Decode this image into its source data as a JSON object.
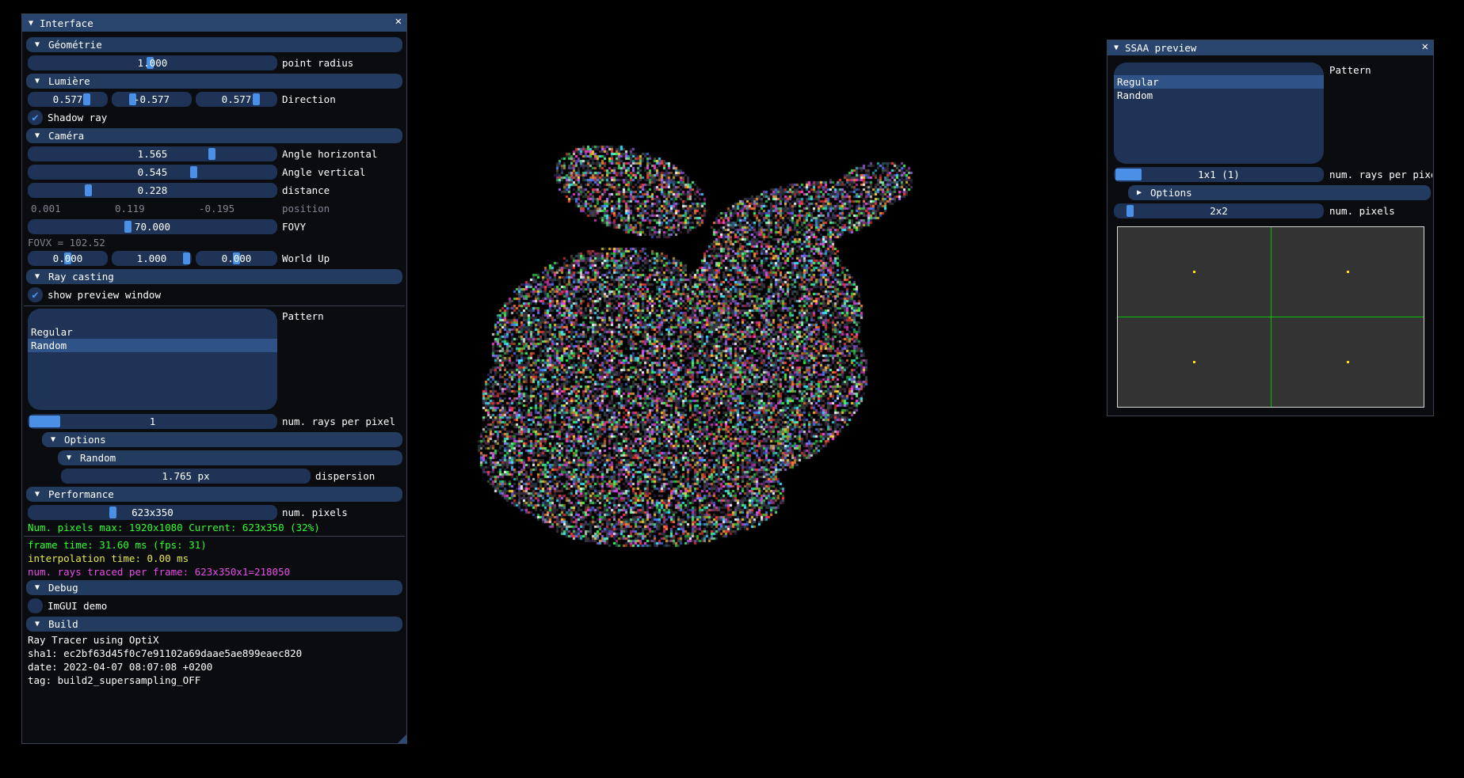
{
  "interface": {
    "title": "Interface",
    "geometry": {
      "header": "Géométrie",
      "point_radius": {
        "value": "1.000",
        "label": "point radius",
        "level": 0.48
      }
    },
    "light": {
      "header": "Lumière",
      "direction": {
        "x": "0.577",
        "y": "-0.577",
        "z": "0.577",
        "label": "Direction"
      },
      "shadow_ray": {
        "label": "Shadow ray",
        "checked": true
      }
    },
    "camera": {
      "header": "Caméra",
      "angle_h": {
        "value": "1.565",
        "label": "Angle horizontal",
        "level": 0.74
      },
      "angle_v": {
        "value": "0.545",
        "label": "Angle vertical",
        "level": 0.66
      },
      "distance": {
        "value": "0.228",
        "label": "distance",
        "level": 0.23
      },
      "position": {
        "x": "0.001",
        "y": "0.119",
        "z": "-0.195",
        "label": "position"
      },
      "fovy": {
        "value": "70.000",
        "label": "FOVY",
        "level": 0.39
      },
      "fovx": "FOVX = 102.52",
      "world_up": {
        "x": "0.000",
        "y": "1.000",
        "z": "0.000",
        "label": "World Up"
      }
    },
    "ray_casting": {
      "header": "Ray casting",
      "show_preview": {
        "label": "show preview window",
        "checked": true
      },
      "pattern_label": "Pattern",
      "patterns": [
        "Regular",
        "Random"
      ],
      "selected_pattern": "Random",
      "rays_per_pixel": {
        "value": "1",
        "label": "num. rays per pixel"
      },
      "options_header": "Options",
      "random_header": "Random",
      "dispersion": {
        "value": "1.765 px",
        "label": "dispersion"
      }
    },
    "performance": {
      "header": "Performance",
      "num_pixels": {
        "value": "623x350",
        "label": "num. pixels",
        "level": 0.33
      },
      "pixels_info": "Num. pixels max: 1920x1080 Current: 623x350 (32%)",
      "frame_time": "frame time: 31.60 ms (fps: 31)",
      "interp_time": "interpolation time: 0.00 ms",
      "rays_traced": "num. rays traced per frame: 623x350x1=218050"
    },
    "debug": {
      "header": "Debug",
      "imgui_demo": {
        "label": "ImGUI demo",
        "checked": false
      }
    },
    "build": {
      "header": "Build",
      "line1": "Ray Tracer using OptiX",
      "sha": "sha1: ec2bf63d45f0c7e91102a69daae5ae899eaec820",
      "date": "date: 2022-04-07 08:07:08 +0200",
      "tag": "tag: build2_supersampling_OFF"
    }
  },
  "ssaa": {
    "title": "SSAA preview",
    "pattern_label": "Pattern",
    "patterns": [
      "Regular",
      "Random"
    ],
    "selected_pattern": "Regular",
    "rays_per_pixel": {
      "value": "1x1 (1)",
      "label": "num. rays per pixel"
    },
    "options_header": "Options",
    "num_pixels": {
      "value": "2x2",
      "label": "num. pixels"
    }
  },
  "colors": {
    "title_bar": "#29456e",
    "header": "#233b5f",
    "frame": "#1e3356",
    "grab": "#4a90e6",
    "grid_line": "#00c000",
    "sample_dot": "#ffe000"
  },
  "icons": [
    "close-icon",
    "collapse-triangle-icon",
    "expand-triangle-icon",
    "checkmark-icon",
    "resize-grip-icon"
  ]
}
